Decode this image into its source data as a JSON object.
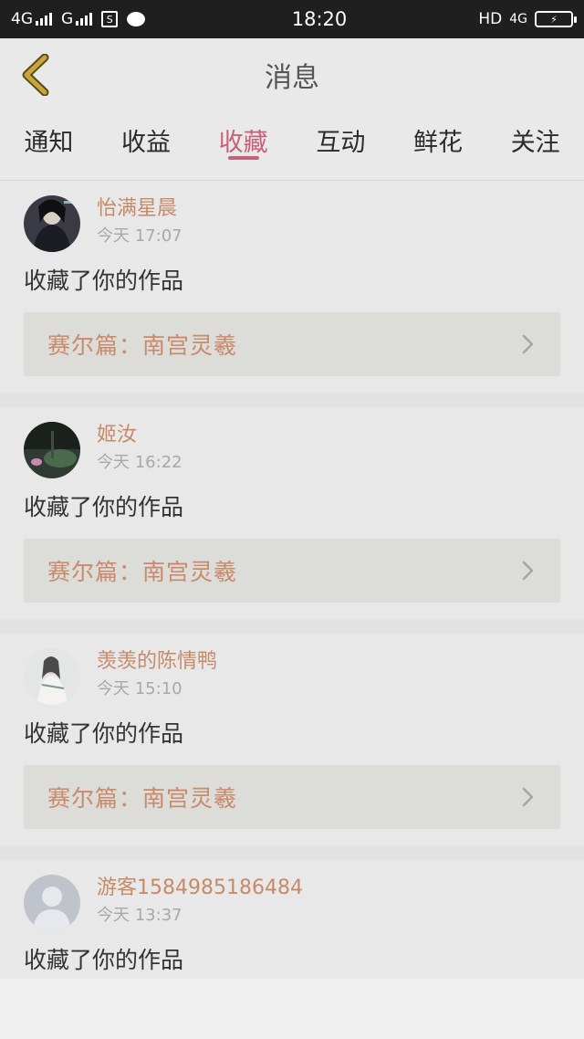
{
  "status_bar": {
    "net1": "4G",
    "net2": "G",
    "time": "18:20",
    "right_label": "HD",
    "right_net": "4G"
  },
  "navbar": {
    "title": "消息",
    "back_icon": "chevron-left-icon",
    "accent": "#c7607a"
  },
  "tabs": [
    {
      "label": "通知"
    },
    {
      "label": "收益"
    },
    {
      "label": "收藏",
      "active": true
    },
    {
      "label": "互动"
    },
    {
      "label": "鲜花"
    },
    {
      "label": "关注"
    }
  ],
  "messages": [
    {
      "username": "怡满星晨",
      "time": "今天 17:07",
      "action": "收藏了你的作品",
      "work": "赛尔篇：南宫灵羲",
      "avatar_icon": "avatar-portrait-icon"
    },
    {
      "username": "姬汝",
      "time": "今天 16:22",
      "action": "收藏了你的作品",
      "work": "赛尔篇：南宫灵羲",
      "avatar_icon": "avatar-lotus-icon"
    },
    {
      "username": "羡羡的陈情鸭",
      "time": "今天 15:10",
      "action": "收藏了你的作品",
      "work": "赛尔篇：南宫灵羲",
      "avatar_icon": "avatar-figure-icon"
    },
    {
      "username": "游客1584985186484",
      "time": "今天 13:37",
      "action": "收藏了你的作品",
      "avatar_icon": "avatar-default-icon"
    }
  ],
  "colors": {
    "username": "#c78a68",
    "work_title": "#c98a6c",
    "timestamp": "#a8a8a8"
  }
}
